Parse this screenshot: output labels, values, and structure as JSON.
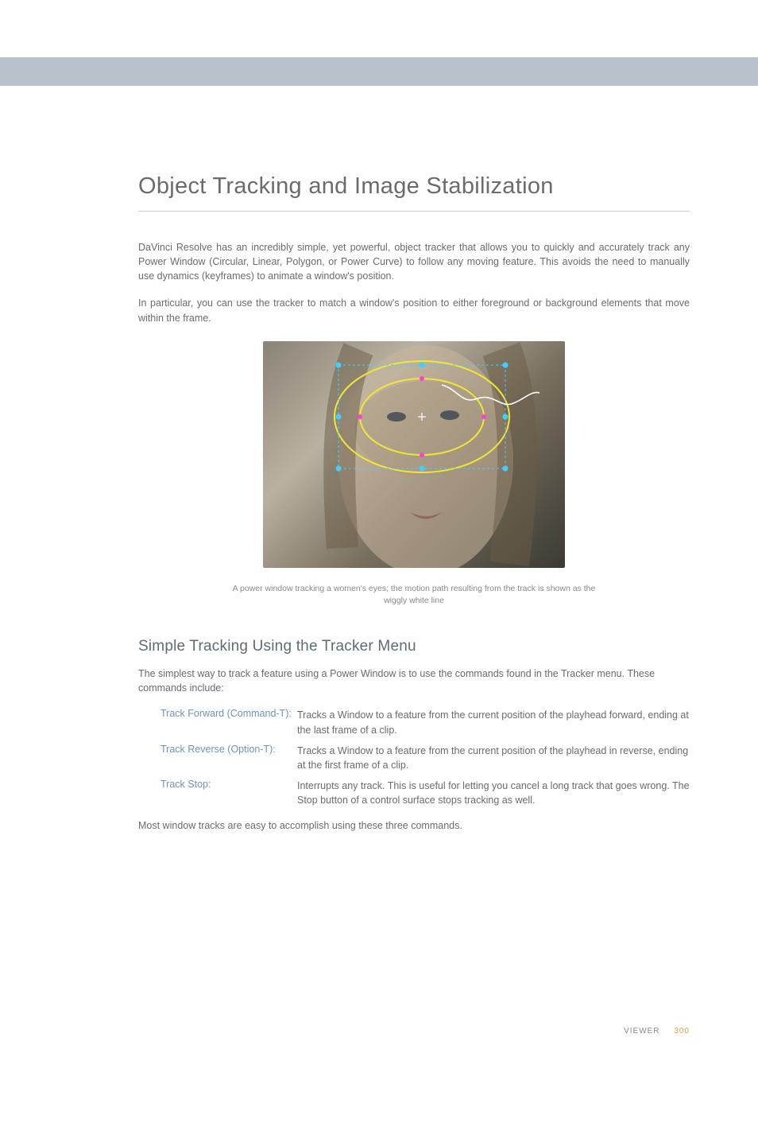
{
  "header": {
    "chapter_title": "Object Tracking and Image Stabilization"
  },
  "intro": {
    "para1": "DaVinci Resolve has an incredibly simple, yet powerful, object tracker that allows you to quickly and accurately track any Power Window (Circular, Linear, Polygon, or Power Curve) to follow any moving feature. This avoids the need to manually use dynamics (keyframes) to animate a window's position.",
    "para2": "In particular, you can use the tracker to match a window's position to either foreground or background elements that move within the frame."
  },
  "figure": {
    "caption": "A power window tracking a women's eyes; the motion path resulting from the track is shown as the wiggly white line"
  },
  "section1": {
    "title": "Simple Tracking Using the Tracker Menu",
    "intro": "The simplest way to track a feature using a Power Window is to use the commands found in the Tracker menu. These commands include:",
    "commands": [
      {
        "term": "Track Forward (Command-T):",
        "desc": "Tracks a Window to a feature from the current position of the playhead forward, ending at the last frame of a clip."
      },
      {
        "term": "Track Reverse (Option-T):",
        "desc": "Tracks a Window to a feature from the current position of the playhead in reverse, ending at the first frame of a clip."
      },
      {
        "term": "Track Stop:",
        "desc": "Interrupts any track. This is useful for letting you cancel a long track that goes wrong. The Stop button of a control surface stops tracking as well."
      }
    ],
    "outro": "Most window tracks are easy to accomplish using these three commands."
  },
  "footer": {
    "section_label": "VIEWER",
    "page_number": "300"
  }
}
